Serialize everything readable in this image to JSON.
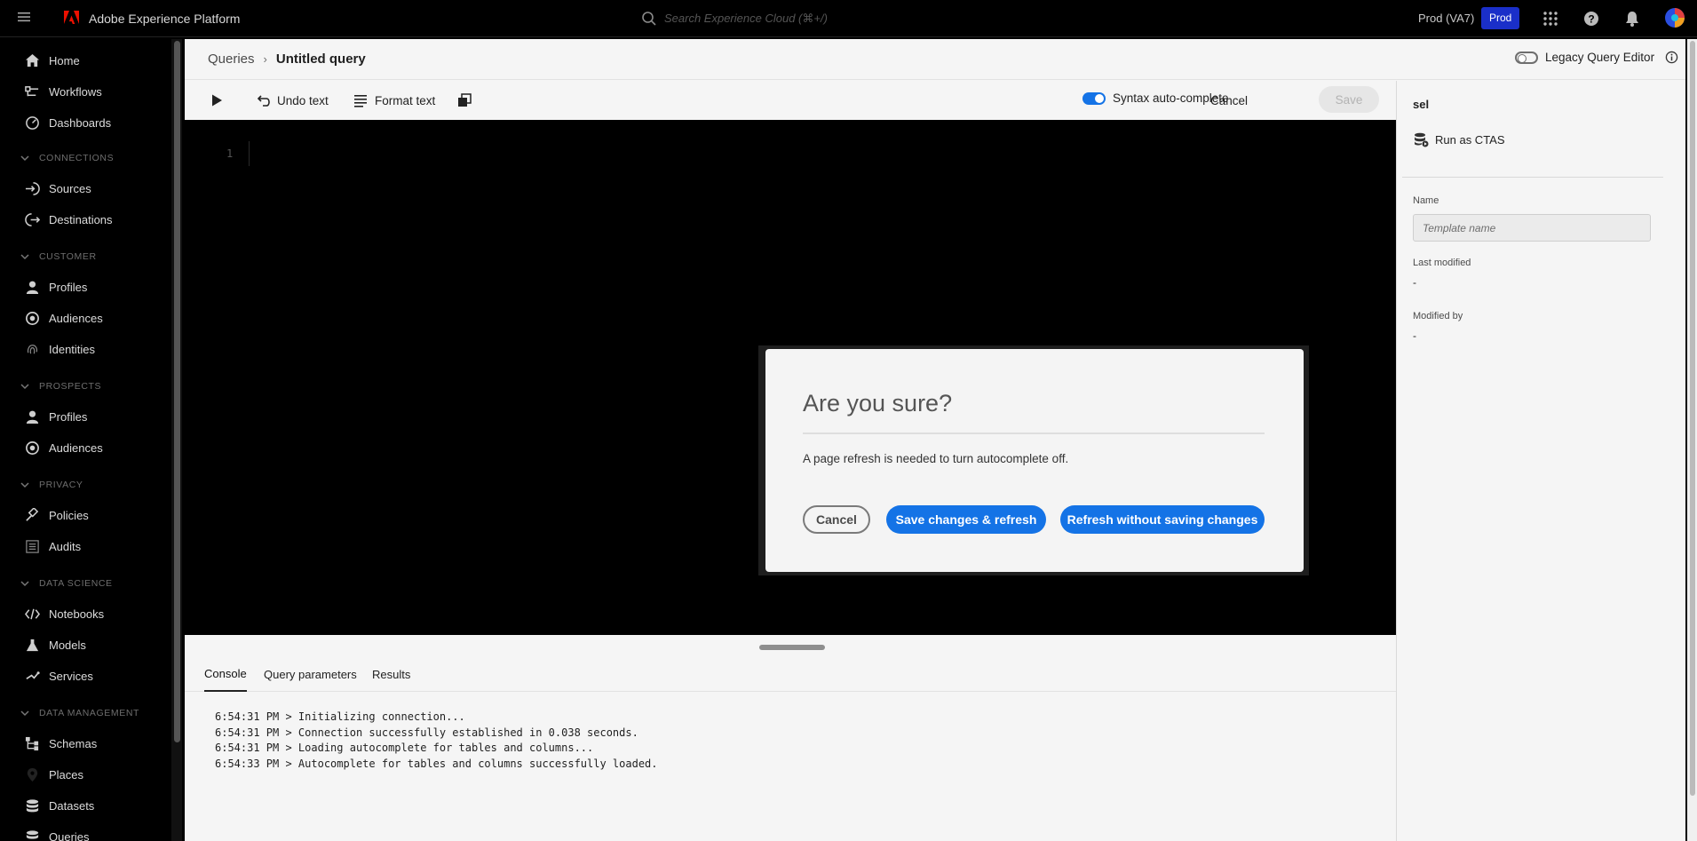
{
  "topbar": {
    "app_title": "Adobe Experience Platform",
    "search_placeholder": "Search Experience Cloud (⌘+/)",
    "org_name": "Prod (VA7)",
    "sandbox_badge": "Prod"
  },
  "sidebar": {
    "top_items": [
      {
        "label": "Home",
        "icon": "home-icon"
      },
      {
        "label": "Workflows",
        "icon": "workflows-icon"
      },
      {
        "label": "Dashboards",
        "icon": "dashboards-icon"
      }
    ],
    "sections": [
      {
        "title": "CONNECTIONS",
        "items": [
          {
            "label": "Sources"
          },
          {
            "label": "Destinations"
          }
        ]
      },
      {
        "title": "CUSTOMER",
        "items": [
          {
            "label": "Profiles"
          },
          {
            "label": "Audiences"
          },
          {
            "label": "Identities"
          }
        ]
      },
      {
        "title": "PROSPECTS",
        "items": [
          {
            "label": "Profiles"
          },
          {
            "label": "Audiences"
          }
        ]
      },
      {
        "title": "PRIVACY",
        "items": [
          {
            "label": "Policies"
          },
          {
            "label": "Audits"
          }
        ]
      },
      {
        "title": "DATA SCIENCE",
        "items": [
          {
            "label": "Notebooks"
          },
          {
            "label": "Models"
          },
          {
            "label": "Services"
          }
        ]
      },
      {
        "title": "DATA MANAGEMENT",
        "items": [
          {
            "label": "Schemas"
          },
          {
            "label": "Places"
          },
          {
            "label": "Datasets"
          },
          {
            "label": "Queries"
          }
        ]
      }
    ]
  },
  "header": {
    "breadcrumb_parent": "Queries",
    "breadcrumb_separator": "›",
    "breadcrumb_current": "Untitled query",
    "legacy_toggle_label": "Legacy Query Editor"
  },
  "toolbar": {
    "undo_label": "Undo text",
    "format_label": "Format text",
    "syntax_label": "Syntax auto-complete",
    "cancel_label": "Cancel",
    "save_label": "Save"
  },
  "editor": {
    "line_number": "1"
  },
  "console": {
    "tabs": [
      "Console",
      "Query parameters",
      "Results"
    ],
    "active_tab": "Console",
    "lines": [
      "6:54:31 PM > Initializing connection...",
      "6:54:31 PM > Connection successfully established in 0.038 seconds.",
      "6:54:31 PM > Loading autocomplete for tables and columns...",
      "6:54:33 PM > Autocomplete for tables and columns successfully loaded."
    ]
  },
  "right_panel": {
    "title": "sel",
    "run_ctas_label": "Run as CTAS",
    "name_label": "Name",
    "name_placeholder": "Template name",
    "last_modified_label": "Last modified",
    "last_modified_value": "-",
    "modified_by_label": "Modified by",
    "modified_by_value": "-"
  },
  "modal": {
    "title": "Are you sure?",
    "message": "A page refresh is needed to turn autocomplete off.",
    "cancel_label": "Cancel",
    "save_refresh_label": "Save changes & refresh",
    "refresh_no_save_label": "Refresh without saving changes"
  },
  "colors": {
    "accent_blue": "#1473e6",
    "badge_blue": "#1a2fc9",
    "adobe_red": "#eb1000"
  }
}
